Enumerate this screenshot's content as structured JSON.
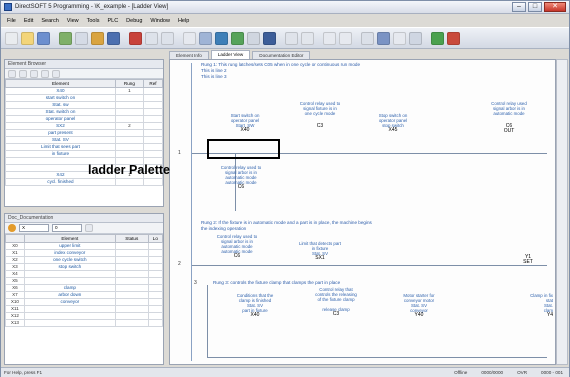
{
  "app": {
    "title": "DirectSOFT 5 Programming - \\K_example - [Ladder View]",
    "callout": "ladder Palette"
  },
  "menu": [
    "File",
    "Edit",
    "Search",
    "View",
    "Tools",
    "PLC",
    "Debug",
    "Window",
    "Help"
  ],
  "left_top": {
    "header": "Element Browser",
    "columns": [
      "Element",
      "Rung",
      "Ref"
    ],
    "rows": [
      {
        "element": "X40",
        "rung": "1",
        "ref": ""
      },
      {
        "element": "start switch on",
        "rung": "",
        "ref": ""
      },
      {
        "element": "Stat. sw",
        "rung": "",
        "ref": ""
      },
      {
        "element": "Stat. switch on",
        "rung": "",
        "ref": ""
      },
      {
        "element": "operator panel",
        "rung": "",
        "ref": ""
      },
      {
        "element": "SX2",
        "rung": "2",
        "ref": ""
      },
      {
        "element": "part present",
        "rung": "",
        "ref": ""
      },
      {
        "element": "Stat. SV",
        "rung": "",
        "ref": ""
      },
      {
        "element": "Limit that sees part",
        "rung": "",
        "ref": ""
      },
      {
        "element": "in fixture",
        "rung": "",
        "ref": ""
      },
      {
        "element": "",
        "rung": "",
        "ref": ""
      },
      {
        "element": "",
        "rung": "",
        "ref": ""
      },
      {
        "element": "X42",
        "rung": "1",
        "ref": ""
      },
      {
        "element": "cycl. finished",
        "rung": "",
        "ref": ""
      }
    ]
  },
  "left_bottom": {
    "header": "Doc_Documentation",
    "combo1": "X",
    "combo2": "0",
    "columns": [
      "Element",
      "Status",
      "Lo"
    ],
    "rows": [
      {
        "id": "X0",
        "element": "upper limit"
      },
      {
        "id": "X1",
        "element": "index conveyor"
      },
      {
        "id": "X2",
        "element": "one cycle switch"
      },
      {
        "id": "X3",
        "element": "stop switch"
      },
      {
        "id": "X4",
        "element": ""
      },
      {
        "id": "X5",
        "element": ""
      },
      {
        "id": "X6",
        "element": "clamp"
      },
      {
        "id": "X7",
        "element": "arbor down"
      },
      {
        "id": "X10",
        "element": "conveyor"
      },
      {
        "id": "X11",
        "element": ""
      },
      {
        "id": "X12",
        "element": ""
      },
      {
        "id": "X13",
        "element": ""
      }
    ]
  },
  "tabs": [
    "Element Info",
    "Ladder View",
    "Documentation Editor"
  ],
  "rungs": [
    {
      "number": "1",
      "comment": "Rung 1: This rung latches/sets C05 when in one cycle or continuous run mode",
      "comment2": "This is line 2",
      "comment3": "This is line 3",
      "elements": [
        {
          "desc": "Start switch on",
          "desc2": "operator panel",
          "name": "Start_SW",
          "addr": "X40"
        },
        {
          "desc": "Control relay used to",
          "desc2": "signal fixture is in",
          "desc3": "one cycle mode",
          "addr": "C3"
        },
        {
          "desc": "Stop switch on",
          "desc2": "operator panel",
          "desc3": "stop switch",
          "addr": "X45"
        },
        {
          "desc": "Control relay used",
          "desc2": "signal arbor is in",
          "desc3": "automatic mode",
          "addr": "C6"
        }
      ],
      "branch": {
        "desc": "Control relay used to",
        "desc2": "signal arbor is in",
        "desc3": "automatic mode",
        "desc4": "automatic mode",
        "addr": "C6"
      },
      "coil": "OUT"
    },
    {
      "number": "2",
      "comment": "Rung 2: If the fixture is in automatic mode and a part is in place, the machine begins",
      "comment2": "the indexing operation",
      "elements": [
        {
          "desc": "Control relay used to",
          "desc2": "signal arbor is in",
          "desc3": "automatic mode",
          "desc4": "automatic mode",
          "addr": "C6"
        },
        {
          "desc": "Limit that detects part",
          "desc2": "in fixture",
          "desc3": "Stat. SV",
          "addr": "SX1"
        }
      ],
      "coil": "SET",
      "coil_addr": "Y1"
    },
    {
      "number": "3",
      "comment": "Rung 3: controls the fixture clamp that clamps the part in place",
      "elements": [
        {
          "desc": "Conditions that the",
          "desc2": "clamp is finished",
          "desc3": "Stat. SV",
          "desc4": "part in fixture",
          "addr": "X40"
        },
        {
          "desc": "Control relay that",
          "desc2": "controls the releasing",
          "desc3": "of the fixture clamp",
          "desc4": "release clamp",
          "addr": "C3"
        },
        {
          "desc": "Motor starter for",
          "desc2": "conveyor motor",
          "desc3": "Stat. SV",
          "desc4": "conveyor",
          "addr": "Y40"
        },
        {
          "desc": "Clamp in fix",
          "desc2": "stat",
          "desc3": "Stat.",
          "desc4": "clam",
          "addr": "Y4"
        }
      ]
    }
  ],
  "status": {
    "left": "For Help, press F1",
    "mode": "Offline",
    "right1": "0000/0000",
    "right2": "OVR",
    "right3": "0000 - 001"
  }
}
